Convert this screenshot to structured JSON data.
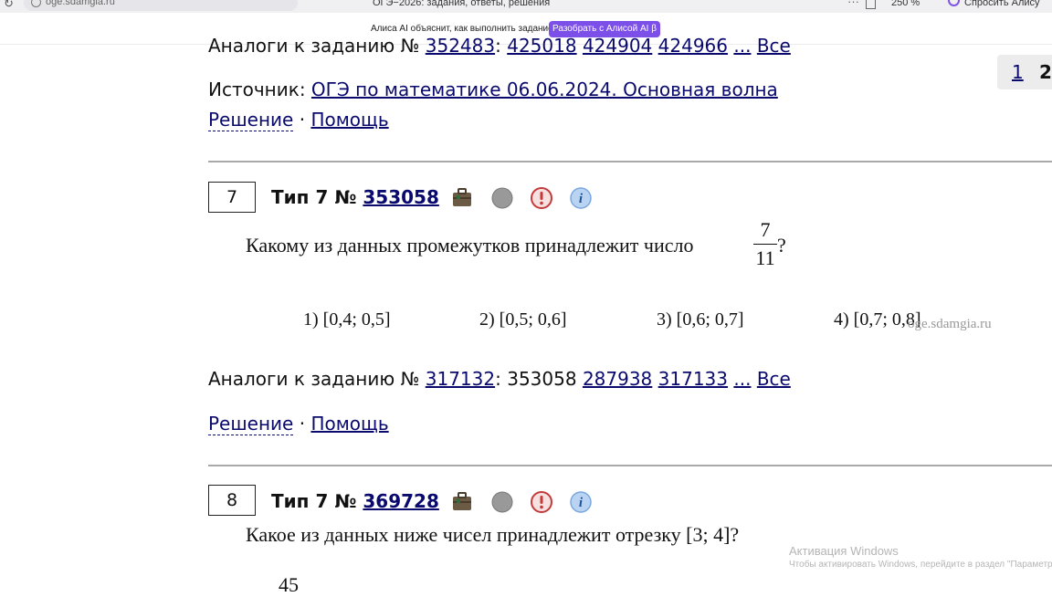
{
  "browser": {
    "url": "oge.sdamgia.ru",
    "tab_title": "ОГЭ−2026: задания, ответы, решения",
    "zoom": "250 %",
    "alice_button": "Спросить Алису AI",
    "menu_dots": "···"
  },
  "alice_bar": {
    "text": "Алиса AI объяснит, как выполнить задание",
    "button": "Разобрать с Алисой AI β"
  },
  "task6": {
    "analogs_label": "Аналоги к заданию №",
    "analogs": [
      "352483",
      "425018",
      "424904",
      "424966"
    ],
    "ellipsis": "...",
    "all": "Все",
    "source_label": "Источник:",
    "source_link": "ОГЭ по математике 06.06.2024. Основная волна",
    "solution": "Решение",
    "help": "Помощь",
    "dot": "·"
  },
  "task7": {
    "number": "7",
    "type_label": "Тип 7 №",
    "id": "353058",
    "question_pre": "Какому из данных промежутков принадлежит число",
    "fraction_num": "7",
    "fraction_den": "11",
    "question_post": "?",
    "options": [
      "1) [0,4; 0,5]",
      "2) [0,5; 0,6]",
      "3) [0,6; 0,7]",
      "4) [0,7; 0,8]"
    ],
    "analogs_label": "Аналоги к заданию №",
    "analog_first": "317132",
    "analog_self": "353058",
    "analogs": [
      "287938",
      "317133"
    ],
    "ellipsis": "...",
    "all": "Все",
    "solution": "Решение",
    "help": "Помощь",
    "dot": "·"
  },
  "task8": {
    "number": "8",
    "type_label": "Тип 7 №",
    "id": "369728",
    "question": "Какое из данных ниже чисел принадлежит отрезку [3; 4]?",
    "partial_value": "45"
  },
  "pager": {
    "page1": "1",
    "page2": "2"
  },
  "watermark": "oge.sdamgia.ru",
  "activation": {
    "title": "Активация Windows",
    "text": "Чтобы активировать Windows, перейдите в раздел \"Параметры\""
  },
  "colors": {
    "link": "#0a0a6e",
    "alice": "#7b4fe8",
    "separator": "#a9a9a9",
    "info": "#7aa7e0",
    "warn": "#d23a3a"
  },
  "icons": [
    "briefcase-icon",
    "gray-circle-icon",
    "exclamation-icon",
    "info-icon"
  ]
}
